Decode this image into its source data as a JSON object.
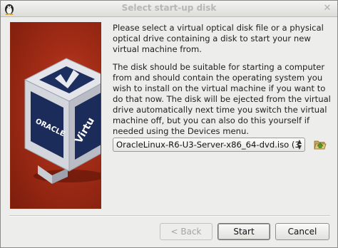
{
  "window": {
    "title": "Select start-up disk",
    "close_glyph": "✕"
  },
  "banner": {
    "logo_text": "ORACLE",
    "product_text": "Virtu"
  },
  "content": {
    "paragraph1": "Please select a virtual optical disk file or a physical optical drive containing a disk to start your new virtual machine from.",
    "paragraph2": "The disk should be suitable for starting a computer from and should contain the operating system you wish to install on the virtual machine if you want to do that now. The disk will be ejected from the virtual drive automatically next time you switch the virtual machine off, but you can also do this yourself if needed using the Devices menu."
  },
  "disk_selector": {
    "selected_value": "OracleLinux-R6-U3-Server-x86_64-dvd.iso (3"
  },
  "buttons": {
    "back_label": "< Back",
    "start_label": "Start",
    "cancel_label": "Cancel"
  },
  "icons": {
    "app": "penguin-icon",
    "close": "close-icon",
    "folder": "folder-open-icon"
  }
}
